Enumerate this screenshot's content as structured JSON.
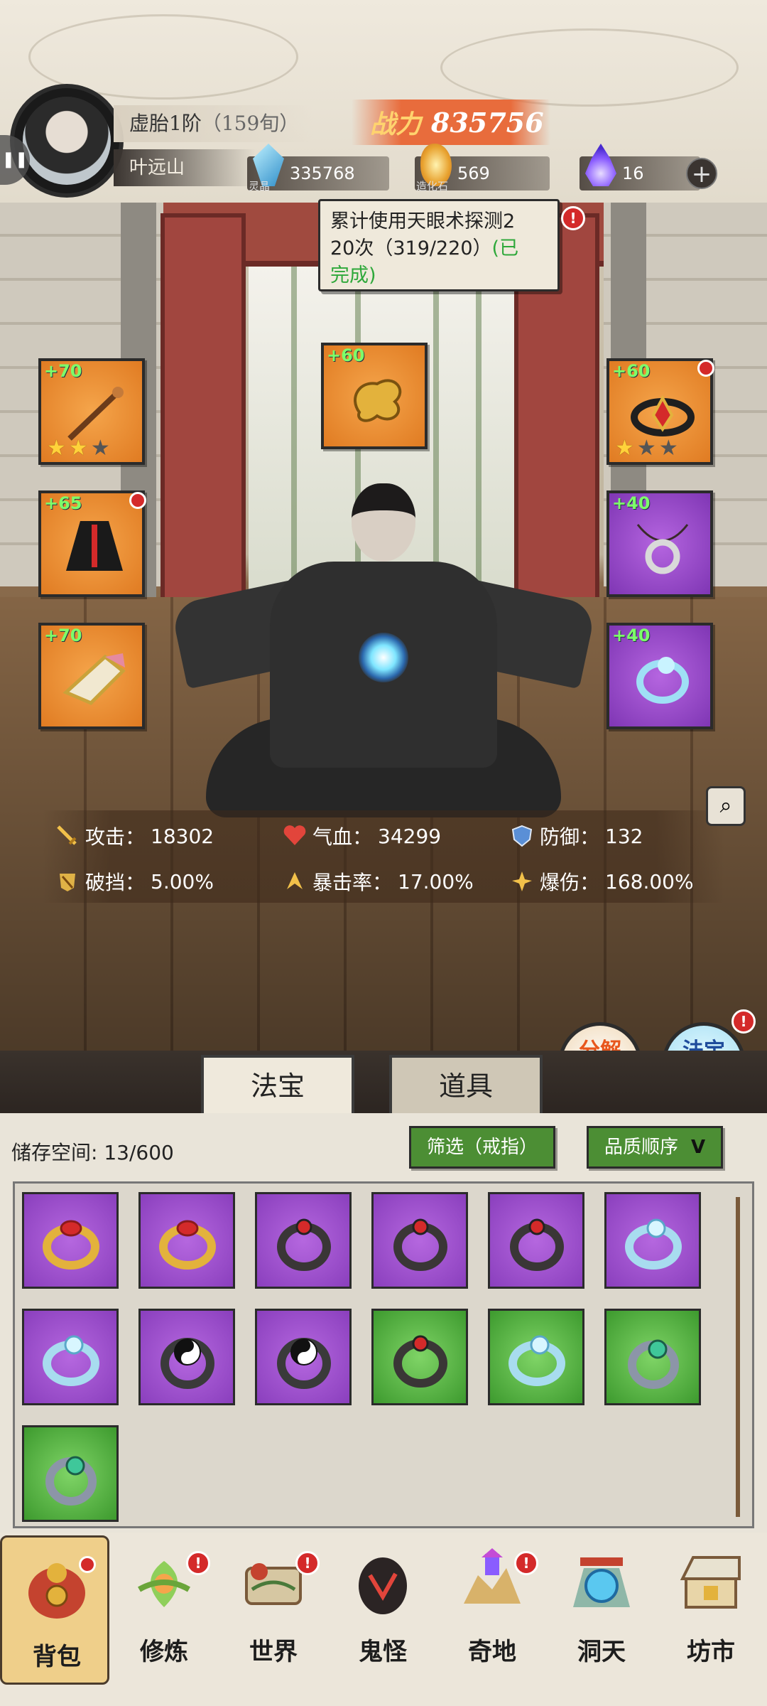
{
  "player": {
    "realm": "虚胎1阶",
    "age": "（159旬）",
    "name": "叶远山"
  },
  "power": {
    "label": "战力",
    "value": "835756"
  },
  "resources": [
    {
      "name": "灵晶",
      "value": "335768",
      "icon": "crystal-icon"
    },
    {
      "name": "造化石",
      "value": "569",
      "icon": "creation-stone-icon"
    },
    {
      "name": "",
      "value": "16",
      "icon": "spirit-flame-icon"
    }
  ],
  "quest": {
    "line1": "累计使用天眼术探测2",
    "line2": "20次（319/220）",
    "status_a": "(已",
    "status_b": "完成)",
    "badge": "!"
  },
  "equipment": [
    {
      "slot": "weapon",
      "bonus": "+70",
      "stars": 2,
      "max_stars": 3,
      "rarity": "orange",
      "icon": "staff-icon",
      "alert": false
    },
    {
      "slot": "center",
      "bonus": "+60",
      "stars": 0,
      "max_stars": 0,
      "rarity": "orange",
      "icon": "cloud-charm-icon",
      "alert": false
    },
    {
      "slot": "crown",
      "bonus": "+60",
      "stars": 1,
      "max_stars": 3,
      "rarity": "orange",
      "icon": "crown-icon",
      "alert": true
    },
    {
      "slot": "robe",
      "bonus": "+65",
      "stars": 0,
      "max_stars": 0,
      "rarity": "orange",
      "icon": "robe-icon",
      "alert": true
    },
    {
      "slot": "necklace",
      "bonus": "+40",
      "stars": 0,
      "max_stars": 0,
      "rarity": "purple",
      "icon": "pendant-icon",
      "alert": false
    },
    {
      "slot": "boots",
      "bonus": "+70",
      "stars": 0,
      "max_stars": 0,
      "rarity": "orange",
      "icon": "boots-icon",
      "alert": false
    },
    {
      "slot": "ring",
      "bonus": "+40",
      "stars": 0,
      "max_stars": 0,
      "rarity": "purple",
      "icon": "ring-icon",
      "alert": false
    }
  ],
  "stats": [
    {
      "label": "攻击：",
      "value": "18302",
      "icon": "sword-icon"
    },
    {
      "label": "气血：",
      "value": "34299",
      "icon": "heart-icon"
    },
    {
      "label": "防御：",
      "value": "132",
      "icon": "shield-icon"
    },
    {
      "label": "破挡：",
      "value": "5.00%",
      "icon": "break-icon"
    },
    {
      "label": "暴击率：",
      "value": "17.00%",
      "icon": "crit-icon"
    },
    {
      "label": "爆伤：",
      "value": "168.00%",
      "icon": "crit-damage-icon"
    }
  ],
  "actions": {
    "decompose": "分解\n再造",
    "synthesize": "法宝\n合成",
    "synthesize_badge": "!"
  },
  "tabs": [
    "法宝",
    "道具"
  ],
  "inventory": {
    "storage_label": "储存空间:",
    "storage_value": "13/600",
    "filter": "筛选（戒指）",
    "sort": "品质顺序",
    "items": [
      {
        "rarity": "purple",
        "ring": "gold-red"
      },
      {
        "rarity": "purple",
        "ring": "gold-red"
      },
      {
        "rarity": "purple",
        "ring": "dark-red"
      },
      {
        "rarity": "purple",
        "ring": "dark-red"
      },
      {
        "rarity": "purple",
        "ring": "dark-red"
      },
      {
        "rarity": "purple",
        "ring": "silver-blue"
      },
      {
        "rarity": "purple",
        "ring": "silver-blue"
      },
      {
        "rarity": "purple",
        "ring": "yin-yang"
      },
      {
        "rarity": "purple",
        "ring": "yin-yang"
      },
      {
        "rarity": "green",
        "ring": "dark-red"
      },
      {
        "rarity": "green",
        "ring": "silver-blue"
      },
      {
        "rarity": "green",
        "ring": "jade-green"
      },
      {
        "rarity": "green",
        "ring": "jade-green"
      }
    ]
  },
  "nav": [
    {
      "label": "背包",
      "icon": "backpack-icon",
      "alert": true,
      "active": true
    },
    {
      "label": "修炼",
      "icon": "cultivate-icon",
      "alert": true,
      "active": false
    },
    {
      "label": "世界",
      "icon": "world-icon",
      "alert": true,
      "active": false
    },
    {
      "label": "鬼怪",
      "icon": "ghost-icon",
      "alert": false,
      "active": false
    },
    {
      "label": "奇地",
      "icon": "wonderland-icon",
      "alert": true,
      "active": false
    },
    {
      "label": "洞天",
      "icon": "cave-heaven-icon",
      "alert": false,
      "active": false
    },
    {
      "label": "坊市",
      "icon": "market-icon",
      "alert": false,
      "active": false
    }
  ],
  "colors": {
    "green_done": "#2ea83a",
    "power_bg": "#e86c3c",
    "alert": "#d42a2a",
    "rarity_orange": "#e07b22",
    "rarity_purple": "#8a3fbd",
    "rarity_green": "#3d9a2e"
  }
}
